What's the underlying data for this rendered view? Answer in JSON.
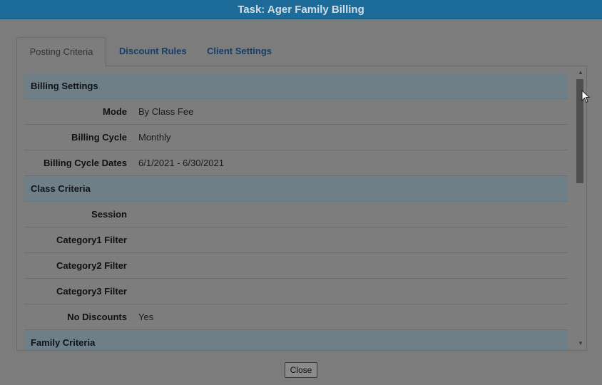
{
  "window": {
    "title": "Task: Ager Family Billing"
  },
  "tabs": [
    {
      "label": "Posting Criteria",
      "active": true
    },
    {
      "label": "Discount Rules",
      "active": false
    },
    {
      "label": "Client Settings",
      "active": false
    }
  ],
  "sections": {
    "billing_settings": {
      "title": "Billing Settings",
      "rows": [
        {
          "label": "Mode",
          "value": "By Class Fee"
        },
        {
          "label": "Billing Cycle",
          "value": "Monthly"
        },
        {
          "label": "Billing Cycle Dates",
          "value": "6/1/2021 - 6/30/2021"
        }
      ]
    },
    "class_criteria": {
      "title": "Class Criteria",
      "rows": [
        {
          "label": "Session",
          "value": ""
        },
        {
          "label": "Category1 Filter",
          "value": ""
        },
        {
          "label": "Category2 Filter",
          "value": ""
        },
        {
          "label": "Category3 Filter",
          "value": ""
        },
        {
          "label": "No Discounts",
          "value": "Yes"
        }
      ]
    },
    "family_criteria": {
      "title": "Family Criteria"
    }
  },
  "footer": {
    "close_label": "Close"
  },
  "icons": {
    "scroll_up": "scroll-up-arrow-icon",
    "scroll_down": "scroll-down-arrow-icon",
    "cursor": "mouse-pointer-icon"
  },
  "colors": {
    "titlebar": "#1c6b98",
    "section_header": "#6f7f88",
    "tab_text": "#123f69"
  }
}
